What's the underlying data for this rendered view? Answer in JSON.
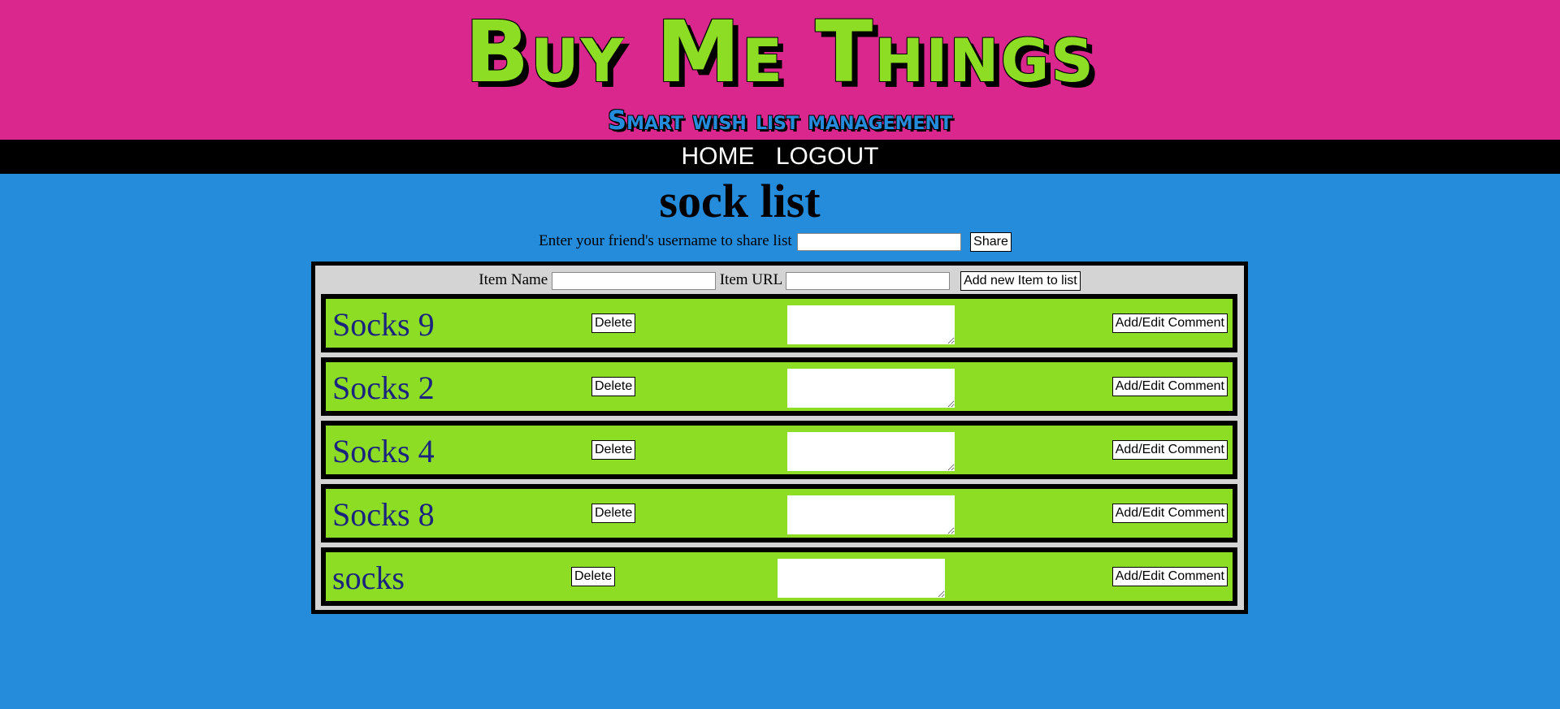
{
  "header": {
    "title": "Buy Me Things",
    "subtitle": "Smart wish list management"
  },
  "nav": {
    "home": "HOME",
    "logout": "LOGOUT"
  },
  "list": {
    "title": "sock list",
    "share_label": "Enter your friend's username to share list",
    "share_value": "",
    "share_button": "Share"
  },
  "add_item": {
    "name_label": "Item Name",
    "name_value": "",
    "url_label": "Item URL",
    "url_value": "",
    "add_button": "Add new Item to list"
  },
  "items": [
    {
      "name": "Socks 9",
      "delete": "Delete",
      "comment": "",
      "comment_button": "Add/Edit Comment"
    },
    {
      "name": "Socks 2",
      "delete": "Delete",
      "comment": "",
      "comment_button": "Add/Edit Comment"
    },
    {
      "name": "Socks 4",
      "delete": "Delete",
      "comment": "",
      "comment_button": "Add/Edit Comment"
    },
    {
      "name": "Socks 8",
      "delete": "Delete",
      "comment": "",
      "comment_button": "Add/Edit Comment"
    },
    {
      "name": "socks",
      "delete": "Delete",
      "comment": "",
      "comment_button": "Add/Edit Comment"
    }
  ],
  "colors": {
    "header_bg": "#da278e",
    "title_green": "#8edd25",
    "page_bg": "#258cdc",
    "item_bg": "#8edd25",
    "list_bg": "#d4d4d4"
  }
}
